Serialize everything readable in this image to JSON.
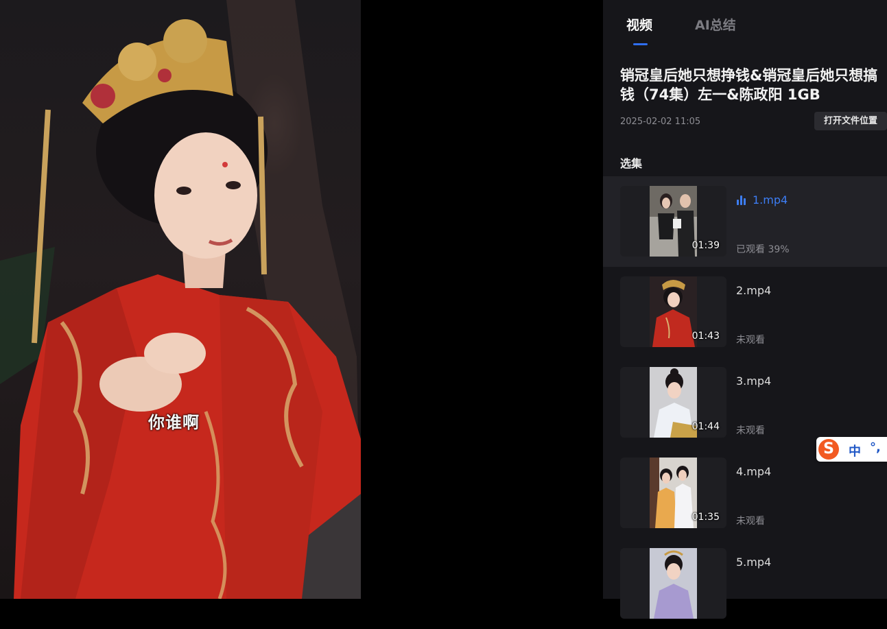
{
  "player": {
    "subtitle": "你谁啊"
  },
  "panel": {
    "tabs": [
      {
        "label": "视频",
        "active": true
      },
      {
        "label": "AI总结",
        "active": false
      }
    ],
    "title": "销冠皇后她只想挣钱&销冠皇后她只想搞钱（74集）左一&陈政阳 1GB",
    "date": "2025-02-02 11:05",
    "open_location_label": "打开文件位置",
    "section_label": "选集",
    "episodes": [
      {
        "name": "1.mp4",
        "duration": "01:39",
        "status": "已观看 39%",
        "playing": true
      },
      {
        "name": "2.mp4",
        "duration": "01:43",
        "status": "未观看",
        "playing": false
      },
      {
        "name": "3.mp4",
        "duration": "01:44",
        "status": "未观看",
        "playing": false
      },
      {
        "name": "4.mp4",
        "duration": "01:35",
        "status": "未观看",
        "playing": false
      },
      {
        "name": "5.mp4",
        "duration": "",
        "status": "",
        "playing": false
      }
    ]
  },
  "ime": {
    "logo": "S",
    "mode": "中",
    "punct": "°,"
  },
  "colors": {
    "accent": "#3d7ef5",
    "panel_bg": "#16161a",
    "active_row_bg": "#222227"
  }
}
